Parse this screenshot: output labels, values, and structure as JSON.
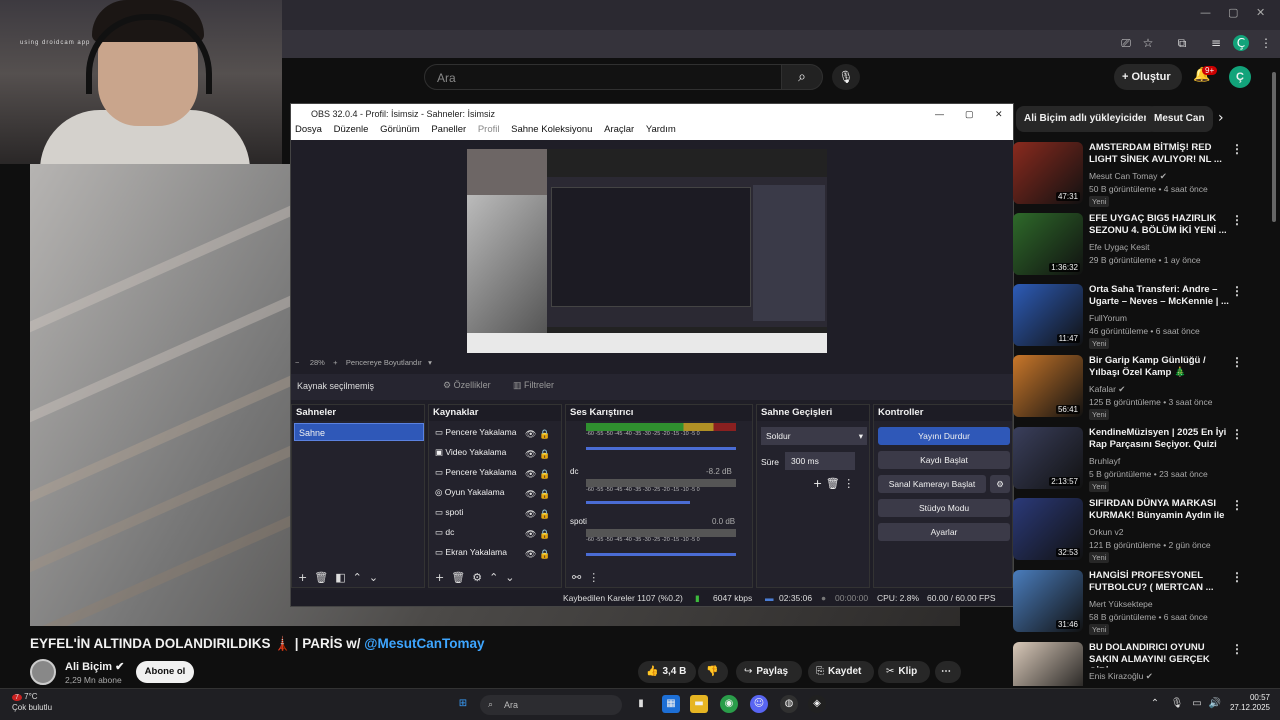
{
  "browser": {
    "window_controls": [
      "—",
      "▢",
      "✕"
    ]
  },
  "youtube": {
    "search_placeholder": "Ara",
    "create_label": "Oluştur",
    "notif_count": "9+",
    "avatar_letter": "Ç"
  },
  "webcam": {
    "label": "using droidcam app"
  },
  "obs": {
    "title": "OBS 32.0.4 - Profil: İsimsiz - Sahneler: İsimsiz",
    "menu": [
      "Dosya",
      "Düzenle",
      "Görünüm",
      "Paneller",
      "Profil",
      "Sahne Koleksiyonu",
      "Araçlar",
      "Yardım"
    ],
    "zoom": "28%",
    "fit_label": "Pencereye Boyutlandır",
    "no_source": "Kaynak seçilmemiş",
    "properties": "Özellikler",
    "filters": "Filtreler",
    "panels": {
      "scenes": "Sahneler",
      "sources": "Kaynaklar",
      "mixer": "Ses Karıştırıcı",
      "transitions": "Sahne Geçişleri",
      "controls": "Kontroller"
    },
    "scene_items": [
      "Sahne"
    ],
    "sources": [
      "Pencere Yakalama",
      "Video Yakalama",
      "Pencere Yakalama",
      "Oyun Yakalama",
      "spoti",
      "dc",
      "Ekran Yakalama"
    ],
    "mixer": {
      "scale": "-60 -55 -50 -45 -40 -35 -30 -25 -20 -15 -10 -5 0",
      "track2_name": "dc",
      "track2_db": "-8.2 dB",
      "track3_name": "spoti",
      "track3_db": "0.0 dB"
    },
    "transition": "Soldur",
    "duration_label": "Süre",
    "duration_value": "300 ms",
    "controls": [
      "Yayını Durdur",
      "Kaydı Başlat",
      "Sanal Kamerayı Başlat",
      "Stüdyo Modu",
      "Ayarlar"
    ],
    "status": {
      "dropped": "Kaybedilen Kareler 1107 (%0.2)",
      "bitrate": "6047 kbps",
      "stream_time": "02:35:06",
      "rec_time": "00:00:00",
      "cpu": "CPU: 2.8%",
      "fps": "60.00 / 60.00 FPS"
    }
  },
  "chips": [
    "Ali Biçim adlı yükleyiciden",
    "Mesut Can"
  ],
  "recommendations": [
    {
      "title": "AMSTERDAM BİTMİŞ! RED LIGHT SİNEK AVLIYOR! NL ...",
      "channel": "Mesut Can Tomay ✔",
      "meta": "50 B görüntüleme • 4 saat önce",
      "duration": "47:31",
      "new": "Yeni",
      "color": "#8a2a1e"
    },
    {
      "title": "EFE UYGAÇ BIG5 HAZIRLIK SEZONU 4. BÖLÜM İKİ YENİ ...",
      "channel": "Efe Uygaç Kesit",
      "meta": "29 B görüntüleme • 1 ay önce",
      "duration": "1:36:32",
      "new": "",
      "color": "#2e6a2a"
    },
    {
      "title": "Orta Saha Transferi: Andre – Ugarte – Neves – McKennie | ...",
      "channel": "FullYorum",
      "meta": "46 görüntüleme • 6 saat önce",
      "duration": "11:47",
      "new": "Yeni",
      "color": "#2d5cb8"
    },
    {
      "title": "Bir Garip Kamp Günlüğü / Yılbaşı Özel Kamp 🎄",
      "channel": "Kafalar ✔",
      "meta": "125 B görüntüleme • 3 saat önce",
      "duration": "56:41",
      "new": "Yeni",
      "color": "#c9772a"
    },
    {
      "title": "KendineMüzisyen | 2025 En İyi Rap Parçasını Seçiyor. Quizi",
      "channel": "Bruhlayf",
      "meta": "5 B görüntüleme • 23 saat önce",
      "duration": "2:13:57",
      "new": "Yeni",
      "color": "#3a3f5c"
    },
    {
      "title": "SIFIRDAN DÜNYA MARKASI KURMAK! Bünyamin Aydın ile ...",
      "channel": "Orkun v2",
      "meta": "121 B görüntüleme • 2 gün önce",
      "duration": "32:53",
      "new": "Yeni",
      "color": "#2b3a7a"
    },
    {
      "title": "HANGİSİ PROFESYONEL FUTBOLCU? ( MERTCAN ...",
      "channel": "Mert Yüksektepe",
      "meta": "58 B görüntüleme • 6 saat önce",
      "duration": "31:46",
      "new": "Yeni",
      "color": "#4a7dbd"
    },
    {
      "title": "BU DOLANDIRICI OYUNU SAKIN ALMAYIN! GERÇEK GİBİ ...",
      "channel": "Enis Kirazoğlu ✔",
      "meta": "",
      "duration": "",
      "new": "",
      "color": "#d9c9b9"
    }
  ],
  "video": {
    "title": "EYFEL'İN ALTINDA DOLANDIRILDIKS 🗼 | PARİS w/ ",
    "mention": "@MesutCanTomay",
    "channel": "Ali Biçim ✔",
    "subs": "2,29 Mn abone",
    "subscribe": "Abone ol",
    "likes": "3,4 B",
    "share": "Paylaş",
    "save": "Kaydet",
    "clip": "Klip"
  },
  "taskbar": {
    "weather_temp": "7°C",
    "weather_desc": "Çok bulutlu",
    "weather_badge": "7",
    "search": "Ara",
    "time": "00:57",
    "date": "27.12.2025"
  }
}
